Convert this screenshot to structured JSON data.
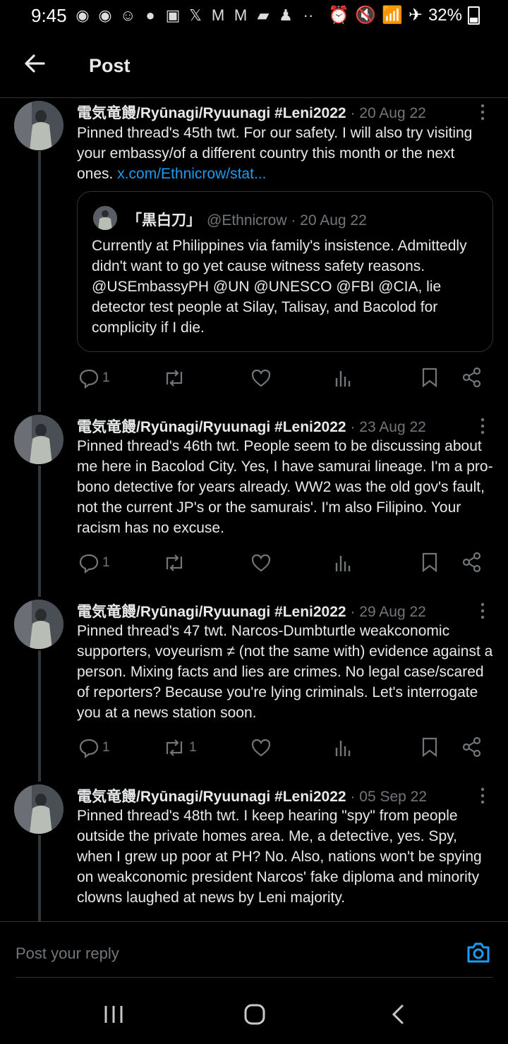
{
  "status_bar": {
    "time": "9:45",
    "battery": "32%",
    "icons": [
      "messenger-icon",
      "messenger-icon",
      "circle-icon",
      "reddit-icon",
      "twitch-icon",
      "x-icon",
      "gmail-icon",
      "gmail-icon",
      "chat-icon",
      "figure-icon",
      "more-dots-icon"
    ],
    "right_icons": [
      "alarm-icon",
      "mute-icon",
      "wifi-icon",
      "airplane-icon"
    ]
  },
  "header": {
    "title": "Post",
    "back_icon": "arrow-left-icon"
  },
  "posts": [
    {
      "name": "電気竜饅/Ryūnagi/Ryuunagi #Leni2022",
      "date": "· 20 Aug 22",
      "text": "Pinned thread's 45th twt. For our safety. I will also try visiting your embassy/of a different country this month or the next ones. ",
      "link": "x.com/Ethnicrow/stat...",
      "quote": {
        "name": "「黒白刀」",
        "handle": "@Ethnicrow · 20 Aug 22",
        "text": "Currently at Philippines via family's insistence. Admittedly didn't want to go yet cause witness safety reasons. @USEmbassyPH @UN @UNESCO @FBI @CIA, lie detector test people at Silay, Talisay, and Bacolod for complicity if I die."
      },
      "replies": "1",
      "reposts": ""
    },
    {
      "name": "電気竜饅/Ryūnagi/Ryuunagi #Leni2022",
      "date": "· 23 Aug 22",
      "text": "Pinned thread's 46th twt. People seem to be discussing about me here in Bacolod City. Yes, I have samurai lineage. I'm a pro-bono detective for years already. WW2 was the old gov's fault, not the current JP's or the samurais'. I'm also Filipino. Your racism has no excuse.",
      "replies": "1",
      "reposts": ""
    },
    {
      "name": "電気竜饅/Ryūnagi/Ryuunagi #Leni2022",
      "date": "· 29 Aug 22",
      "text": "Pinned thread's 47 twt. Narcos-Dumbturtle weakconomic supporters, voyeurism ≠ (not the same with) evidence against a person. Mixing facts and lies are crimes. No legal case/scared of reporters? Because you're lying criminals. Let's interrogate you at a news station soon.",
      "replies": "1",
      "reposts": "1"
    },
    {
      "name": "電気竜饅/Ryūnagi/Ryuunagi #Leni2022",
      "date": "· 05 Sep 22",
      "text": "Pinned thread's 48th twt. I keep hearing \"spy\" from people outside the private homes area. Me, a detective, yes. Spy, when I grew up poor at PH? No. Also, nations won't be spying on weakconomic president Narcos' fake diploma and minority clowns laughed at news by Leni majority."
    }
  ],
  "reply_bar": {
    "placeholder": "Post your reply",
    "camera_icon": "camera-icon"
  },
  "nav_bar": {
    "icons": [
      "recents-icon",
      "home-icon",
      "back-chevron-icon"
    ]
  },
  "colors": {
    "accent": "#1d9bf0",
    "muted": "#71767b",
    "divider": "#2f3336",
    "background": "#000000"
  }
}
